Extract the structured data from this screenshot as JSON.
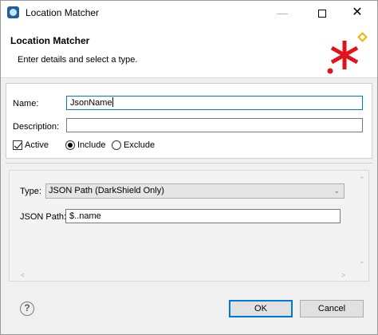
{
  "window": {
    "title": "Location Matcher"
  },
  "banner": {
    "title": "Location Matcher",
    "description": "Enter details and select a type."
  },
  "form": {
    "name_label": "Name:",
    "name_value": "JsonName",
    "description_label": "Description:",
    "description_value": "",
    "active_label": "Active",
    "active_checked": true,
    "include_label": "Include",
    "exclude_label": "Exclude",
    "selected_mode": "Include"
  },
  "details": {
    "type_label": "Type:",
    "type_value": "JSON Path (DarkShield Only)",
    "json_path_label": "JSON Path:",
    "json_path_value": "$..name"
  },
  "buttons": {
    "ok_label": "OK",
    "cancel_label": "Cancel"
  },
  "icons": {
    "help": "?",
    "banner_logo": "red-asterisk-logo"
  },
  "colors": {
    "logo_red": "#e0121b",
    "logo_gold": "#f0b400",
    "focus_blue": "#0078d7"
  }
}
